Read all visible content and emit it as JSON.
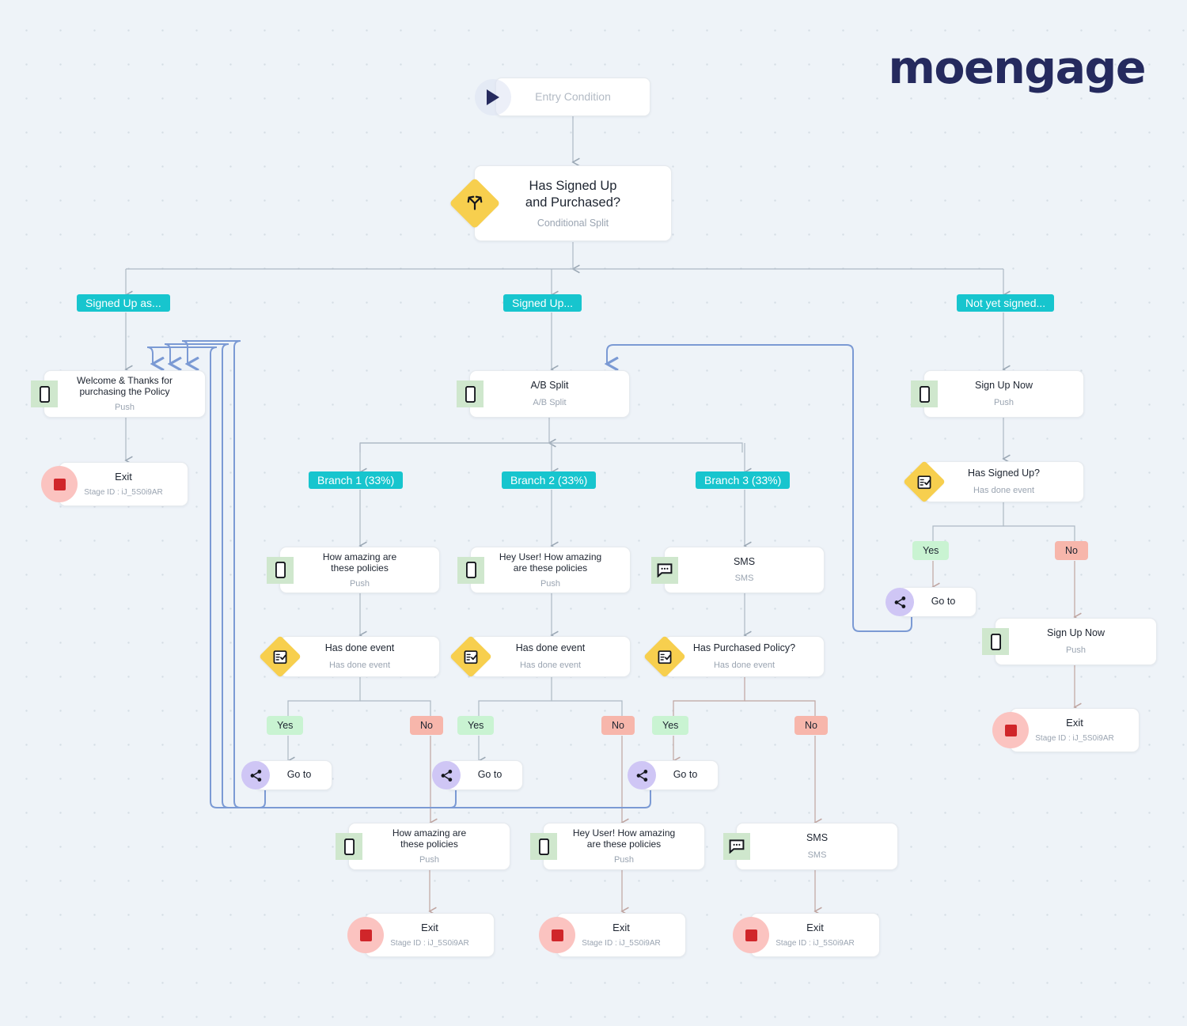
{
  "brand": {
    "name": "moengage",
    "color": "#252a5e"
  },
  "canvas": {
    "background": "#eef3f8",
    "accent_teal": "#17c5ce",
    "yes_color": "#c9f3d2",
    "no_color": "#f7b6ab",
    "push_icon_bg": "#cfe7cd",
    "goto_icon_bg": "#cfc6f5",
    "exit_icon_bg": "#fbc3c0"
  },
  "nodes": {
    "entry": {
      "title": "Entry Condition",
      "icon": "play-icon"
    },
    "main_split": {
      "title": "Has Signed Up\nand Purchased?",
      "sub": "Conditional Split",
      "icon": "conditional-split-icon"
    },
    "welcome_push": {
      "title": "Welcome & Thanks for\npurchasing the Policy",
      "sub": "Push",
      "icon": "push-icon"
    },
    "exit_left": {
      "title": "Exit",
      "sub": "Stage ID : iJ_5S0i9AR",
      "icon": "exit-icon"
    },
    "ab_split": {
      "title": "A/B Split",
      "sub": "A/B Split",
      "icon": "push-icon"
    },
    "b1_push": {
      "title": "How amazing are\nthese policies",
      "sub": "Push",
      "icon": "push-icon"
    },
    "b2_push": {
      "title": "Hey User! How amazing\nare these policies",
      "sub": "Push",
      "icon": "push-icon"
    },
    "b3_sms": {
      "title": "SMS",
      "sub": "SMS",
      "icon": "sms-icon"
    },
    "b1_event": {
      "title": "Has done event",
      "sub": "Has done event",
      "icon": "has-done-event-icon"
    },
    "b2_event": {
      "title": "Has done event",
      "sub": "Has done event",
      "icon": "has-done-event-icon"
    },
    "b3_event": {
      "title": "Has Purchased Policy?",
      "sub": "Has done event",
      "icon": "has-done-event-icon"
    },
    "goto_b1": {
      "title": "Go to",
      "icon": "goto-icon"
    },
    "goto_b2": {
      "title": "Go to",
      "icon": "goto-icon"
    },
    "goto_b3": {
      "title": "Go to",
      "icon": "goto-icon"
    },
    "bottom_push_1": {
      "title": "How amazing are\nthese policies",
      "sub": "Push",
      "icon": "push-icon"
    },
    "bottom_push_2": {
      "title": "Hey User! How amazing\nare these policies",
      "sub": "Push",
      "icon": "push-icon"
    },
    "bottom_sms": {
      "title": "SMS",
      "sub": "SMS",
      "icon": "sms-icon"
    },
    "exit_b1": {
      "title": "Exit",
      "sub": "Stage ID : iJ_5S0i9AR",
      "icon": "exit-icon"
    },
    "exit_b2": {
      "title": "Exit",
      "sub": "Stage ID : iJ_5S0i9AR",
      "icon": "exit-icon"
    },
    "exit_b3": {
      "title": "Exit",
      "sub": "Stage ID : iJ_5S0i9AR",
      "icon": "exit-icon"
    },
    "signup_push": {
      "title": "Sign Up Now",
      "sub": "Push",
      "icon": "push-icon"
    },
    "signup_event": {
      "title": "Has Signed Up?",
      "sub": "Has done event",
      "icon": "has-done-event-icon"
    },
    "goto_right": {
      "title": "Go to",
      "icon": "goto-icon"
    },
    "signup_push_2": {
      "title": "Sign Up Now",
      "sub": "Push",
      "icon": "push-icon"
    },
    "exit_right": {
      "title": "Exit",
      "sub": "Stage ID : iJ_5S0i9AR",
      "icon": "exit-icon"
    }
  },
  "branch_labels": {
    "signed_up_as": "Signed Up as...",
    "signed_up": "Signed Up...",
    "not_yet_signed": "Not yet signed...",
    "branch_1": "Branch 1 (33%)",
    "branch_2": "Branch 2 (33%)",
    "branch_3": "Branch 3 (33%)"
  },
  "condition_labels": {
    "b1_yes": "Yes",
    "b1_no": "No",
    "b2_yes": "Yes",
    "b2_no": "No",
    "b3_yes": "Yes",
    "b3_no": "No",
    "r_yes": "Yes",
    "r_no": "No"
  }
}
